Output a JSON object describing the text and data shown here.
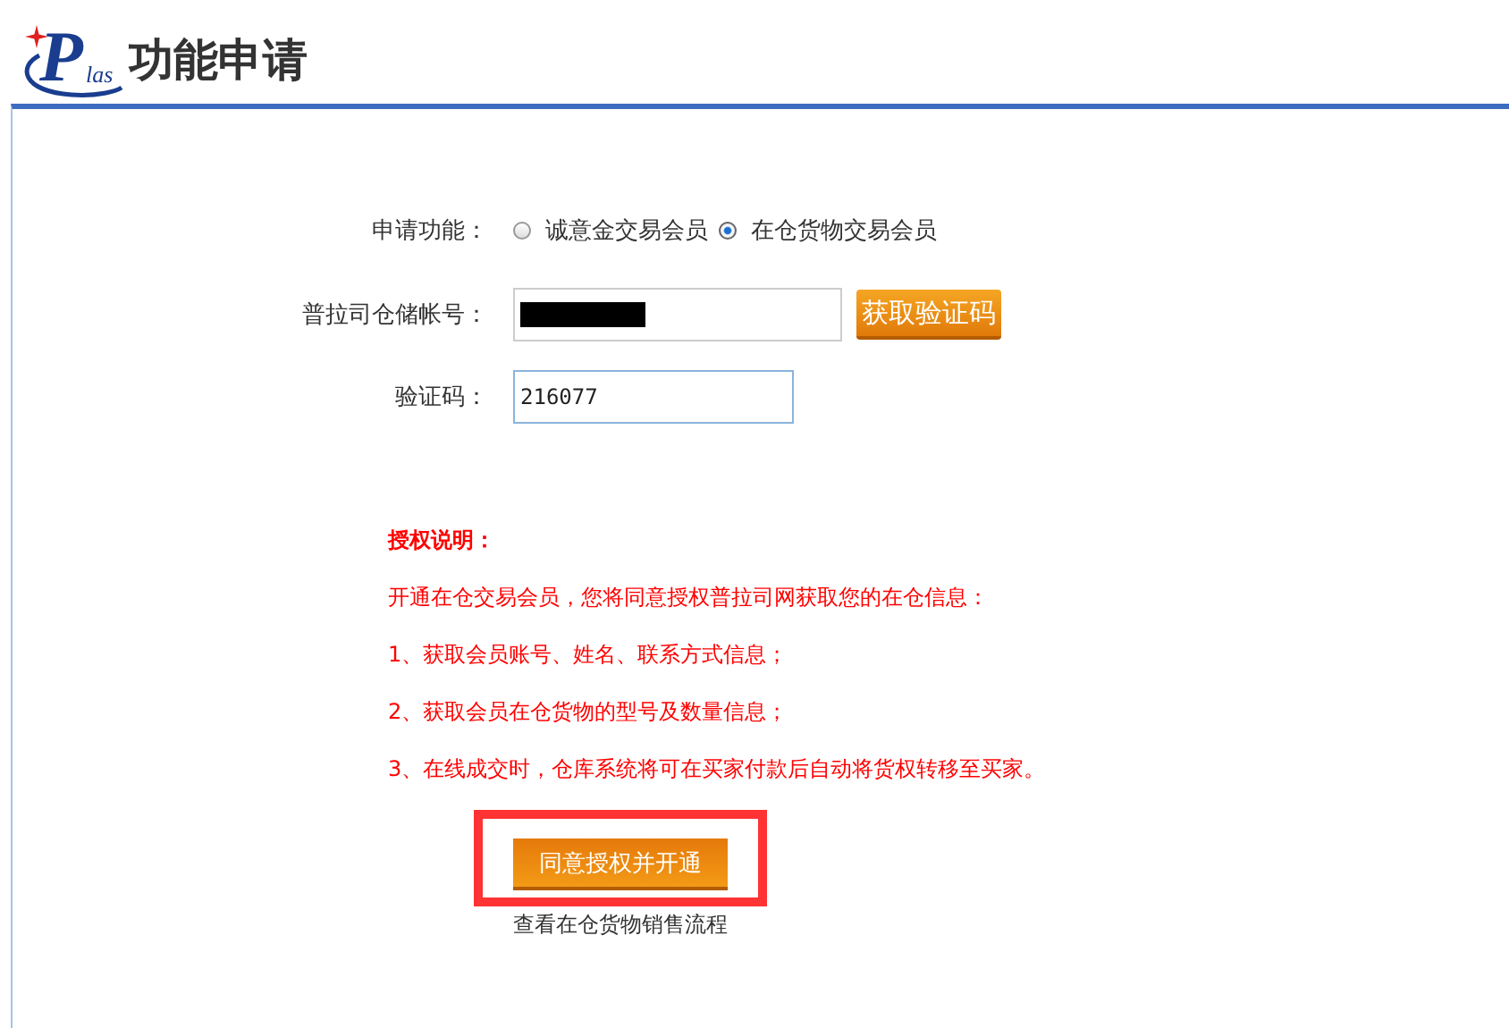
{
  "header": {
    "logo": {
      "initial": "P",
      "rest": "las"
    },
    "title": "功能申请"
  },
  "form": {
    "function_label": "申请功能：",
    "options": [
      {
        "label": "诚意金交易会员",
        "selected": false
      },
      {
        "label": "在仓货物交易会员",
        "selected": true
      }
    ],
    "account_label": "普拉司仓储帐号：",
    "account_redacted": true,
    "get_code_button": "获取验证码",
    "code_label": "验证码：",
    "code_value": "216077"
  },
  "notice": {
    "title": "授权说明：",
    "lines": [
      "开通在仓交易会员，您将同意授权普拉司网获取您的在仓信息：",
      "1、获取会员账号、姓名、联系方式信息；",
      "2、获取会员在仓货物的型号及数量信息；",
      "3、在线成交时，仓库系统将可在买家付款后自动将货权转移至买家。"
    ]
  },
  "submit_button": "同意授权并开通",
  "highlighted": true,
  "flow_link": "查看在仓货物销售流程"
}
